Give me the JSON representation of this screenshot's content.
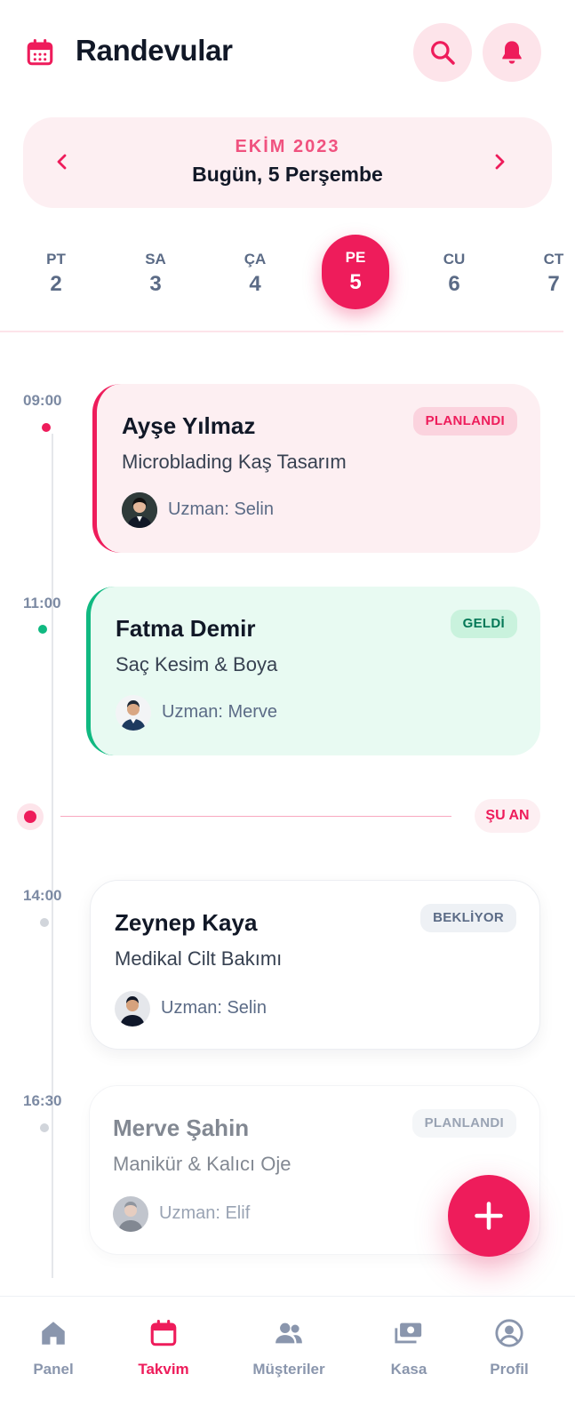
{
  "header": {
    "title": "Randevular",
    "icons": {
      "calendar": "calendar-icon",
      "search": "search-icon",
      "notifications": "bell-icon"
    }
  },
  "month_nav": {
    "month": "EKİM 2023",
    "today": "Bugün, 5 Perşembe",
    "prev_icon": "chevron-left-icon",
    "next_icon": "chevron-right-icon"
  },
  "days": [
    {
      "name": "PT",
      "num": "2",
      "active": false
    },
    {
      "name": "SA",
      "num": "3",
      "active": false
    },
    {
      "name": "ÇA",
      "num": "4",
      "active": false
    },
    {
      "name": "PE",
      "num": "5",
      "active": true
    },
    {
      "name": "CU",
      "num": "6",
      "active": false
    },
    {
      "name": "CT",
      "num": "7",
      "active": false
    }
  ],
  "appointments": [
    {
      "time": "09:00",
      "client": "Ayşe Yılmaz",
      "service": "Microblading Kaş Tasarım",
      "status": "PLANLANDI",
      "expert": "Uzman: Selin"
    },
    {
      "time": "11:00",
      "client": "Fatma Demir",
      "service": "Saç Kesim & Boya",
      "status": "GELDİ",
      "expert": "Uzman: Merve"
    },
    {
      "time": "14:00",
      "client": "Zeynep Kaya",
      "service": "Medikal Cilt Bakımı",
      "status": "BEKLİYOR",
      "expert": "Uzman: Selin"
    },
    {
      "time": "16:30",
      "client": "Merve Şahin",
      "service": "Manikür & Kalıcı Oje",
      "status": "PLANLANDI",
      "expert": "Uzman: Elif"
    }
  ],
  "now_marker": {
    "label": "ŞU AN"
  },
  "fab": {
    "icon": "plus-icon"
  },
  "bottom_nav": [
    {
      "label": "Panel",
      "icon": "home-icon",
      "active": false
    },
    {
      "label": "Takvim",
      "icon": "calendar-icon",
      "active": true
    },
    {
      "label": "Müşteriler",
      "icon": "users-icon",
      "active": false
    },
    {
      "label": "Kasa",
      "icon": "cash-icon",
      "active": false
    },
    {
      "label": "Profil",
      "icon": "profile-icon",
      "active": false
    }
  ],
  "colors": {
    "accent": "#ee1c5b",
    "accent_light": "#fdeff2",
    "success": "#10b981",
    "success_light": "#e8faf2",
    "muted": "#5b6b86"
  }
}
